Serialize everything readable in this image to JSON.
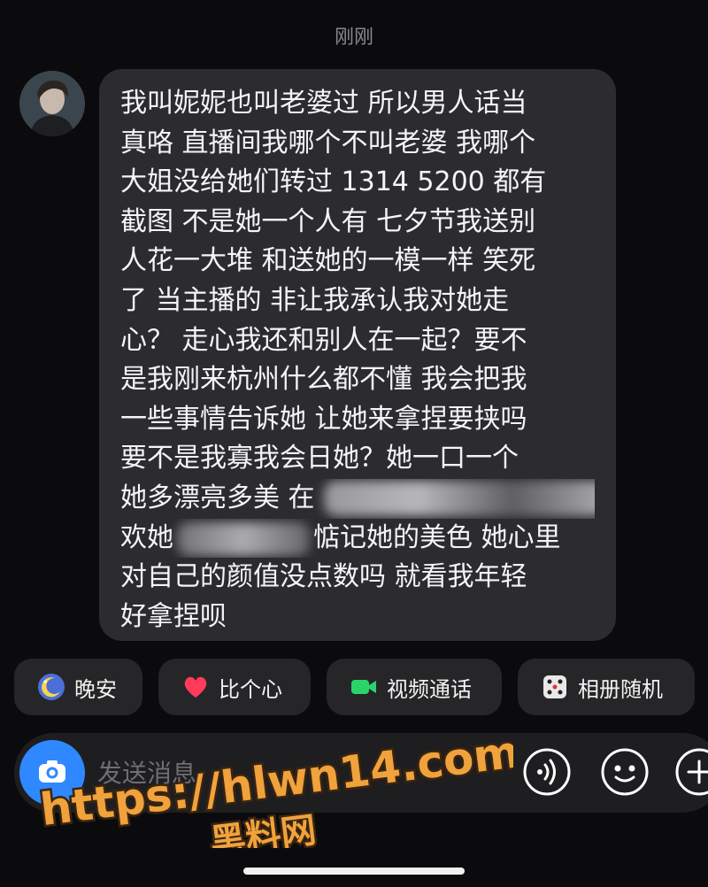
{
  "header": {
    "timestamp": "刚刚"
  },
  "message": {
    "lines": [
      "我叫妮妮也叫老婆过 所以男人话当",
      "真咯 直播间我哪个不叫老婆 我哪个",
      "大姐没给她们转过 1314 5200 都有",
      "截图 不是她一个人有 七夕节我送别",
      "人花一大堆 和送她的一模一样 笑死",
      "了 当主播的 非让我承认我对她走",
      "心？ 走心我还和别人在一起？要不",
      "是我刚来杭州什么都不懂 我会把我",
      "一些事情告诉她 让她来拿捏要挟吗",
      "要不是我寡我会日她？她一口一个",
      "她多漂亮多美 在",
      "欢她",
      "惦记她的美色 她心里",
      "对自己的颜值没点数吗 就看我年轻",
      "好拿捏呗"
    ]
  },
  "quick_actions": [
    {
      "label": "晚安",
      "icon": "moon-icon"
    },
    {
      "label": "比个心",
      "icon": "heart-icon"
    },
    {
      "label": "视频通话",
      "icon": "video-camera-icon"
    },
    {
      "label": "相册随机",
      "icon": "dice-icon"
    }
  ],
  "composer": {
    "placeholder": "发送消息",
    "camera_icon": "camera-icon",
    "voice_icon": "voice-icon",
    "emoji_icon": "emoji-icon",
    "plus_icon": "plus-icon"
  },
  "watermark": {
    "url": "https://hlwn14.com",
    "name": "黑料网"
  },
  "colors": {
    "background": "#0b0b0d",
    "bubble": "#2c2c2e",
    "chip": "#262628",
    "camera_button": "#2f88ff",
    "watermark_fill": "#f0a23c",
    "watermark_stroke": "#3a2410"
  }
}
